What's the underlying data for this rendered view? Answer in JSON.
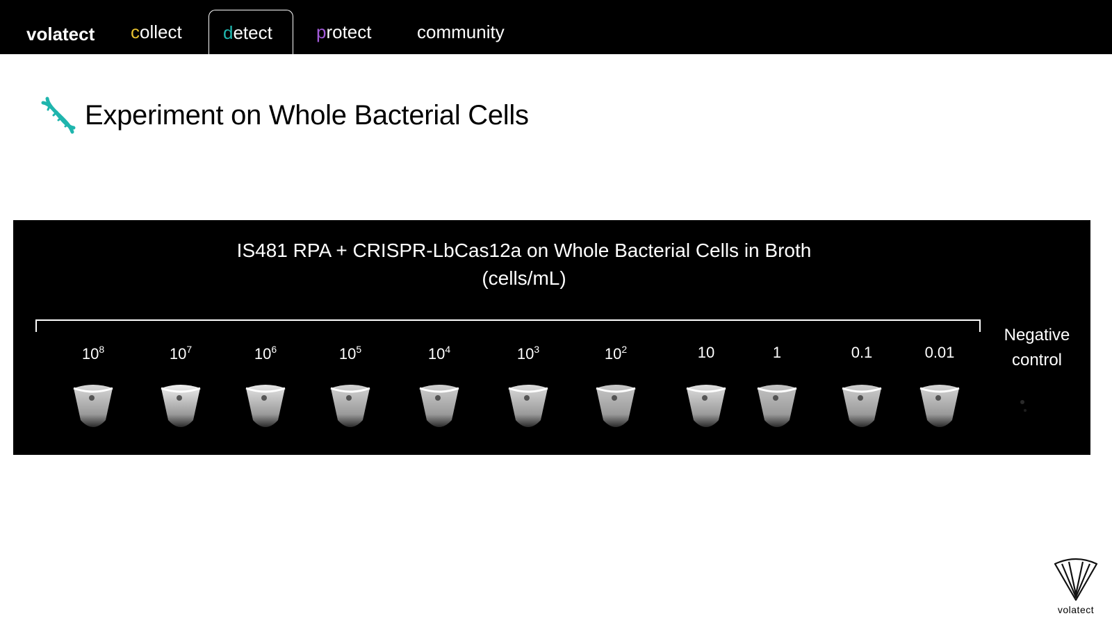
{
  "nav": {
    "brand": "volatect",
    "items": [
      {
        "first": "c",
        "rest": "ollect",
        "accent": "#e8c230"
      },
      {
        "first": "d",
        "rest": "etect",
        "accent": "#20b8b0"
      },
      {
        "first": "p",
        "rest": "rotect",
        "accent": "#a25ad8"
      },
      {
        "first": "",
        "rest": "community",
        "accent": "#ffffff"
      }
    ]
  },
  "heading": {
    "title": "Experiment on Whole Bacterial Cells",
    "icon": "dna-icon",
    "icon_color": "#1fb5ad"
  },
  "figure": {
    "title_line1": "IS481 RPA + CRISPR-LbCas12a on Whole Bacterial Cells in Broth",
    "title_line2": "(cells/mL)",
    "samples": [
      {
        "base": "10",
        "exp": "8"
      },
      {
        "base": "10",
        "exp": "7"
      },
      {
        "base": "10",
        "exp": "6"
      },
      {
        "base": "10",
        "exp": "5"
      },
      {
        "base": "10",
        "exp": "4"
      },
      {
        "base": "10",
        "exp": "3"
      },
      {
        "base": "10",
        "exp": "2"
      },
      {
        "base": "10",
        "exp": ""
      },
      {
        "base": "1",
        "exp": ""
      },
      {
        "base": "0.1",
        "exp": ""
      },
      {
        "base": "0.01",
        "exp": ""
      }
    ],
    "negative_line1": "Negative",
    "negative_line2": "control"
  },
  "logo": {
    "text": "volatect"
  }
}
